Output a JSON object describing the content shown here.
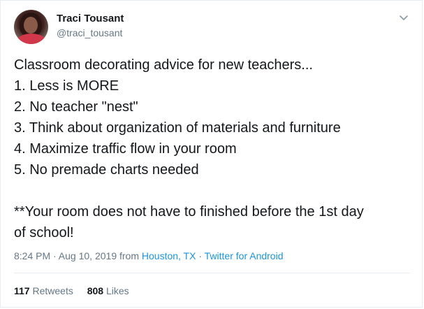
{
  "user": {
    "name": "Traci Tousant",
    "handle": "@traci_tousant"
  },
  "tweet": {
    "lines": [
      "Classroom decorating advice for new teachers...",
      "1. Less is MORE",
      "2. No teacher \"nest\"",
      "3. Think about organization of materials and furniture",
      "4. Maximize traffic flow in your room",
      "5. No premade charts needed",
      "**Your room does not have to finished before the 1st day",
      "of school!"
    ]
  },
  "meta": {
    "time_date": "8:24 PM · Aug 10, 2019 from",
    "location": "Houston, TX",
    "separator": "·",
    "source": "Twitter for Android"
  },
  "stats": {
    "retweets_count": "117",
    "retweets_label": "Retweets",
    "likes_count": "808",
    "likes_label": "Likes"
  },
  "icons": {
    "menu": "chevron-down-icon"
  },
  "colors": {
    "link": "#1b95e0",
    "secondary_text": "#657786",
    "primary_text": "#14171a",
    "divider": "#e6ecf0"
  }
}
